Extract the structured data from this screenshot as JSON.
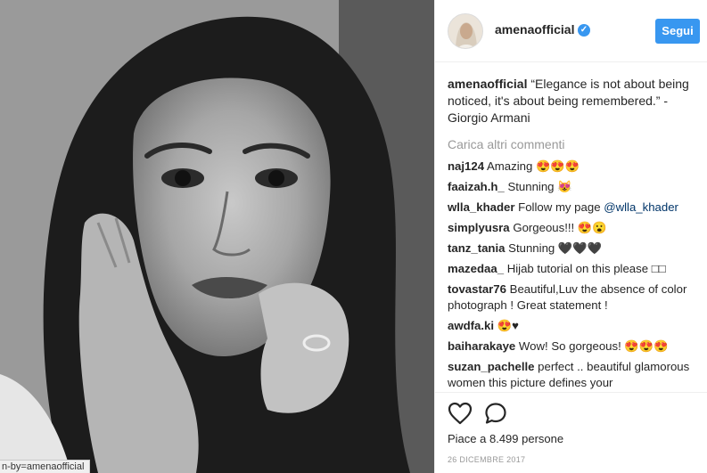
{
  "browser": {
    "status_url": "n-by=amenaofficial"
  },
  "photo": {
    "icon": "portrait-photo"
  },
  "header": {
    "username": "amenaofficial",
    "verified_icon": "verified-badge-icon",
    "follow_label": "Segui",
    "accent_color": "#3897f0"
  },
  "caption": {
    "user": "amenaofficial",
    "text": "“Elegance is not about being noticed, it's about being remembered.” - Giorgio Armani"
  },
  "load_more_label": "Carica altri commenti",
  "comments": [
    {
      "user": "naj124",
      "text": "Amazing 😍😍😍"
    },
    {
      "user": "faaizah.h_",
      "text": "Stunning 😻"
    },
    {
      "user": "wlla_khader",
      "text": "Follow my page ",
      "mention": "@wlla_khader"
    },
    {
      "user": "simplyusra",
      "text": "Gorgeous!!! 😍😮"
    },
    {
      "user": "tanz_tania",
      "text": "Stunning 🖤🖤🖤"
    },
    {
      "user": "mazedaa_",
      "text": "Hijab tutorial on this please □□"
    },
    {
      "user": "tovastar76",
      "text": "Beautiful,Luv the absence of color photograph ! Great statement !"
    },
    {
      "user": "awdfa.ki",
      "text": "😍♥"
    },
    {
      "user": "baiharakaye",
      "text": "Wow! So gorgeous! 😍😍😍"
    },
    {
      "user": "suzan_pachelle",
      "text": "perfect .. beautiful glamorous women this picture defines your"
    }
  ],
  "actions": {
    "like_icon": "heart-icon",
    "comment_icon": "comment-bubble-icon",
    "likes_text": "Piace a 8.499 persone",
    "date": "26 DICEMBRE 2017"
  }
}
